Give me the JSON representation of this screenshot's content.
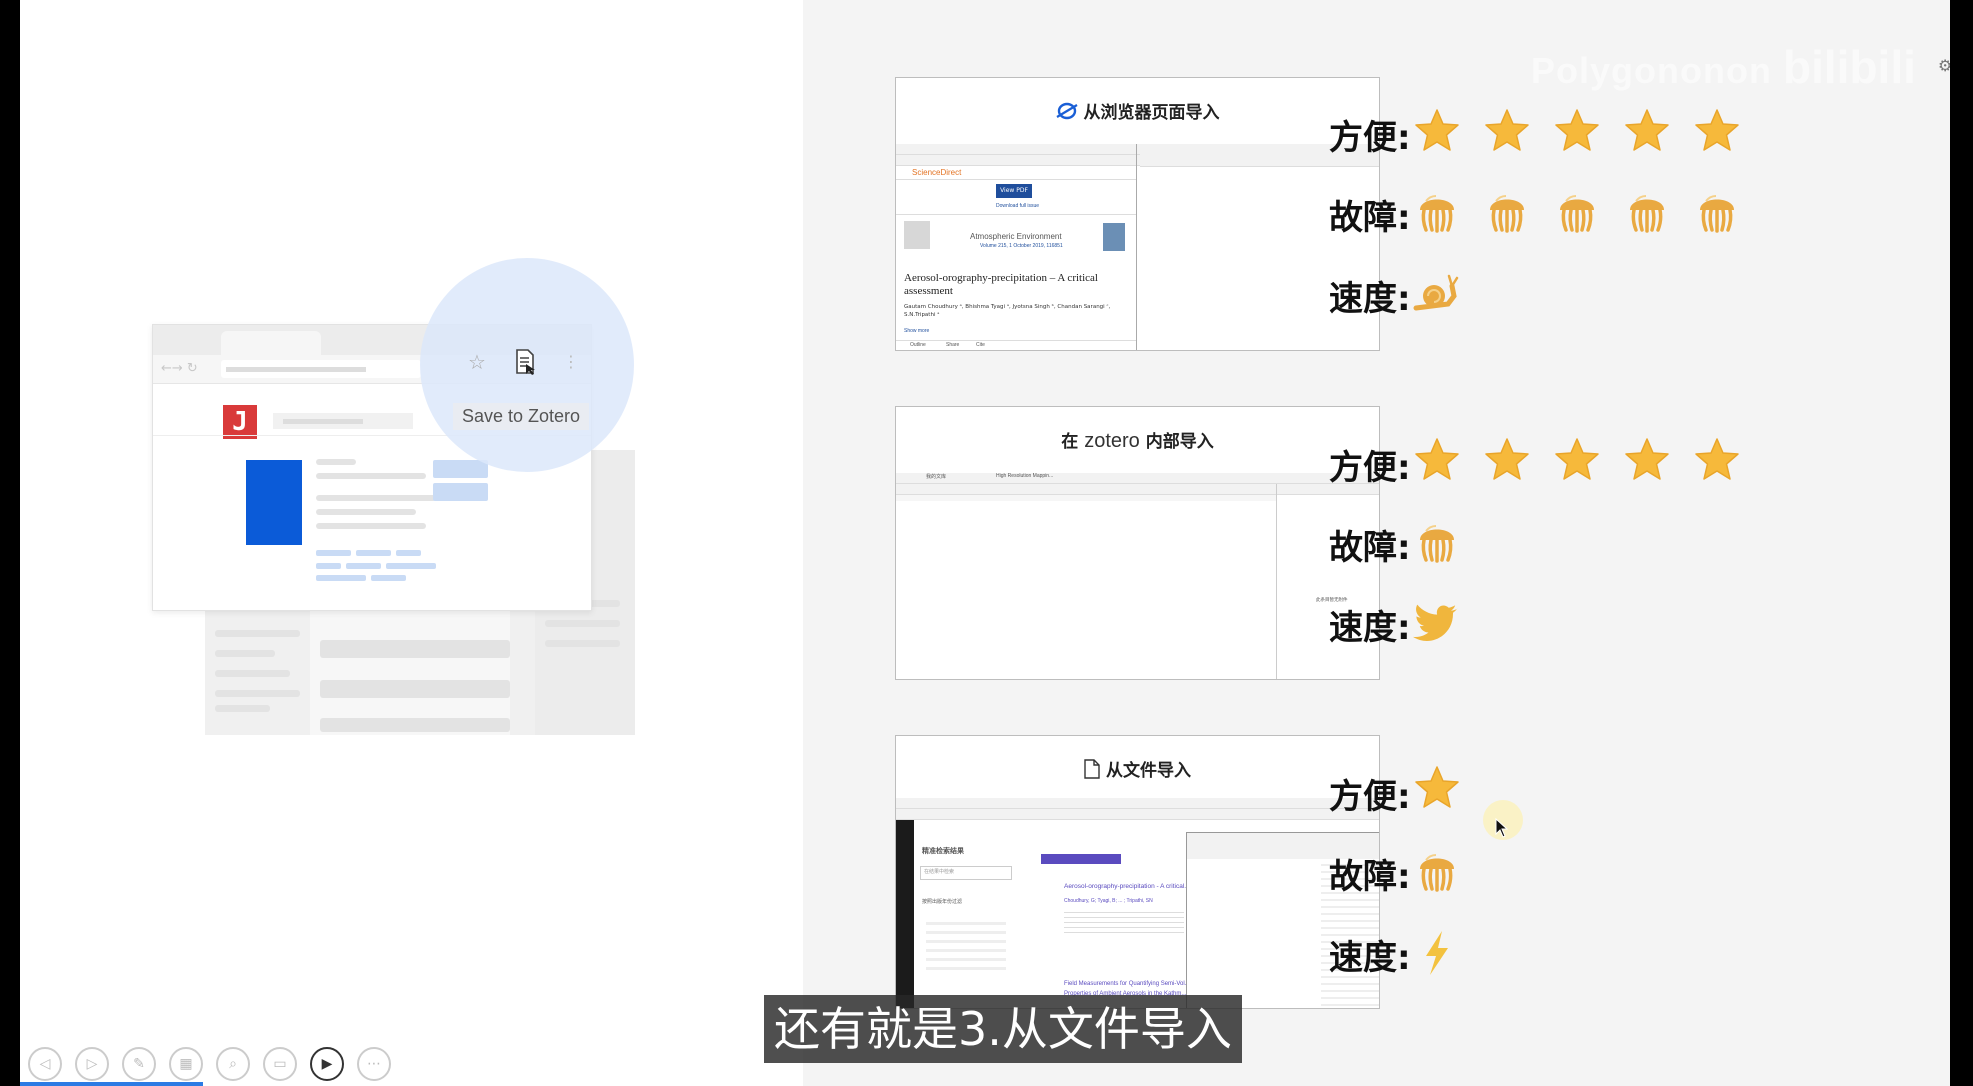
{
  "left_illustration": {
    "zotero_tooltip": "Save to Zotero",
    "logo_letter": "J"
  },
  "rows": [
    {
      "title": "从浏览器页面导入",
      "title_icon": "browser-refresh-icon",
      "inner": {
        "journal": "Atmospheric Environment",
        "journal_sub": "Volume 215, 1 October 2019, 116851",
        "view_pdf": "View PDF",
        "download": "Download full issue",
        "article_title": "Aerosol-orography-precipitation – A critical assessment",
        "authors": "Gautam Choudhury ᵃ, Bhishma Tyagi ᵃ, Jyotsna Singh ᵇ, Chandan Sarangi ᶜ, S.N.Tripathi ᵃ",
        "show_more": "Show more",
        "brand": "ScienceDirect",
        "footer": [
          "Outline",
          "Share",
          "Cite"
        ]
      },
      "ratings": [
        {
          "label": "方便:",
          "icon": "star-icon",
          "count": 5
        },
        {
          "label": "故障:",
          "icon": "jellyfish-icon",
          "count": 5
        },
        {
          "label": "速度:",
          "icon": "snail-icon",
          "count": 1
        }
      ]
    },
    {
      "title_prefix": "在",
      "title_brand": "zotero",
      "title_suffix": "内部导入",
      "inner": {
        "tab1": "我的文库",
        "tab2": "High Resolution Mappin...",
        "side_note": "此条目暂无附件"
      },
      "ratings": [
        {
          "label": "方便:",
          "icon": "star-icon",
          "count": 5
        },
        {
          "label": "故障:",
          "icon": "jellyfish-icon",
          "count": 1
        },
        {
          "label": "速度:",
          "icon": "bird-icon",
          "count": 1
        }
      ]
    },
    {
      "title": "从文件导入",
      "title_icon": "file-icon",
      "inner": {
        "panel_title": "精准检索结果",
        "search_placeholder": "在结果中检索",
        "result1": "Aerosol-orography-precipitation - A critical...",
        "result1_authors": "Choudhury, G; Tyagi, B; ... ; Tripathi, SN",
        "result2": "Field Measurements for Quantifying Semi-Vol...",
        "result2_sub": "Properties of Ambient Aerosols in the Kathm...",
        "filter_label": "按照出版年份过滤"
      },
      "ratings": [
        {
          "label": "方便:",
          "icon": "star-icon",
          "count": 1
        },
        {
          "label": "故障:",
          "icon": "jellyfish-icon",
          "count": 1
        },
        {
          "label": "速度:",
          "icon": "lightning-icon",
          "count": 1
        }
      ]
    }
  ],
  "watermark": "Polygononon",
  "watermark_logo": "bilibili",
  "subtitle": "还有就是3.从文件导入",
  "player_controls": [
    "prev-icon",
    "next-icon",
    "pen-icon",
    "slides-icon",
    "zoom-icon",
    "subtitle-icon",
    "camera-icon",
    "more-icon"
  ],
  "colors": {
    "star": "#f6b93b",
    "jellyfish": "#e9a941",
    "accent_blue": "#1a5fd6"
  }
}
